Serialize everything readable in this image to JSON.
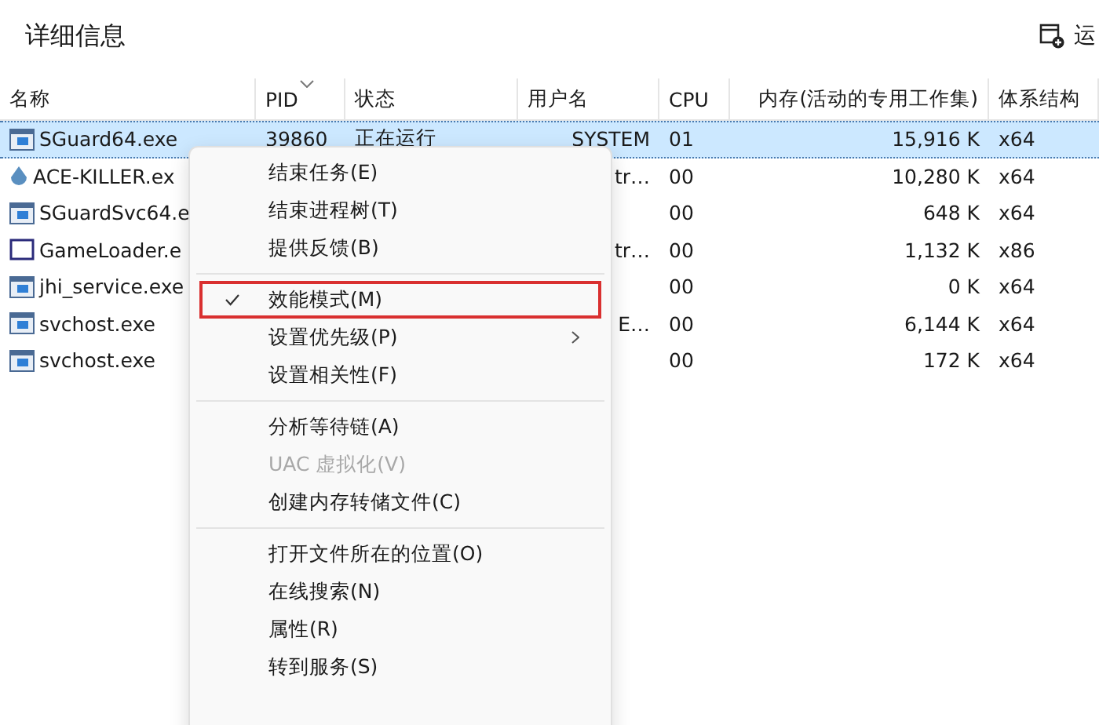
{
  "header": {
    "title": "详细信息",
    "action_label": "运"
  },
  "table": {
    "columns": [
      {
        "label": "名称",
        "sorted": false
      },
      {
        "label": "PID",
        "sorted": true
      },
      {
        "label": "状态",
        "sorted": false
      },
      {
        "label": "用户名",
        "sorted": false
      },
      {
        "label": "CPU",
        "sorted": false
      },
      {
        "label": "内存(活动的专用工作集)",
        "sorted": false
      },
      {
        "label": "体系结构",
        "sorted": false
      }
    ],
    "rows": [
      {
        "kind": "window",
        "selected": true,
        "cells": [
          "SGuard64.exe",
          "39860",
          "正在运行",
          "SYSTEM",
          "01",
          "15,916 K",
          "x64"
        ]
      },
      {
        "kind": "drop",
        "selected": false,
        "cells": [
          "ACE-KILLER.ex",
          "",
          "",
          "tr…",
          "00",
          "10,280 K",
          "x64"
        ]
      },
      {
        "kind": "window",
        "selected": false,
        "cells": [
          "SGuardSvc64.e",
          "",
          "",
          "",
          "00",
          "648 K",
          "x64"
        ]
      },
      {
        "kind": "frame",
        "selected": false,
        "cells": [
          "GameLoader.e",
          "",
          "",
          "tr…",
          "00",
          "1,132 K",
          "x86"
        ]
      },
      {
        "kind": "window",
        "selected": false,
        "cells": [
          "jhi_service.exe",
          "",
          "",
          "",
          "00",
          "0 K",
          "x64"
        ]
      },
      {
        "kind": "window",
        "selected": false,
        "cells": [
          "svchost.exe",
          "",
          "",
          "E…",
          "00",
          "6,144 K",
          "x64"
        ]
      },
      {
        "kind": "window",
        "selected": false,
        "cells": [
          "svchost.exe",
          "",
          "",
          "",
          "00",
          "172 K",
          "x64"
        ]
      }
    ]
  },
  "context_menu": {
    "groups": [
      [
        {
          "label": "结束任务(E)",
          "checked": false,
          "disabled": false,
          "submenu": false,
          "highlighted": false
        },
        {
          "label": "结束进程树(T)",
          "checked": false,
          "disabled": false,
          "submenu": false,
          "highlighted": false
        },
        {
          "label": "提供反馈(B)",
          "checked": false,
          "disabled": false,
          "submenu": false,
          "highlighted": false
        }
      ],
      [
        {
          "label": "效能模式(M)",
          "checked": true,
          "disabled": false,
          "submenu": false,
          "highlighted": true
        },
        {
          "label": "设置优先级(P)",
          "checked": false,
          "disabled": false,
          "submenu": true,
          "highlighted": false
        },
        {
          "label": "设置相关性(F)",
          "checked": false,
          "disabled": false,
          "submenu": false,
          "highlighted": false
        }
      ],
      [
        {
          "label": "分析等待链(A)",
          "checked": false,
          "disabled": false,
          "submenu": false,
          "highlighted": false
        },
        {
          "label": "UAC 虚拟化(V)",
          "checked": false,
          "disabled": true,
          "submenu": false,
          "highlighted": false
        },
        {
          "label": "创建内存转储文件(C)",
          "checked": false,
          "disabled": false,
          "submenu": false,
          "highlighted": false
        }
      ],
      [
        {
          "label": "打开文件所在的位置(O)",
          "checked": false,
          "disabled": false,
          "submenu": false,
          "highlighted": false
        },
        {
          "label": "在线搜索(N)",
          "checked": false,
          "disabled": false,
          "submenu": false,
          "highlighted": false
        },
        {
          "label": "属性(R)",
          "checked": false,
          "disabled": false,
          "submenu": false,
          "highlighted": false
        },
        {
          "label": "转到服务(S)",
          "checked": false,
          "disabled": false,
          "submenu": false,
          "highlighted": false
        }
      ]
    ]
  }
}
